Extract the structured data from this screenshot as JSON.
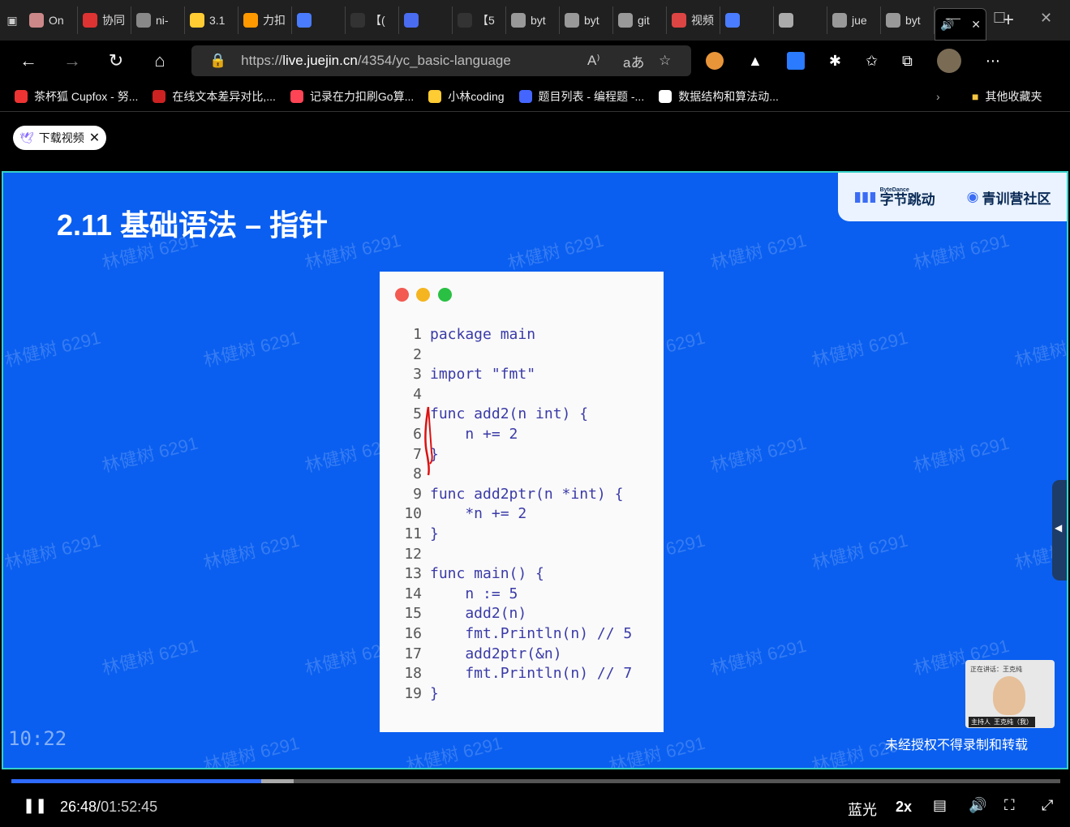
{
  "tabs": [
    {
      "label": "On",
      "color": "#c88"
    },
    {
      "label": "协同",
      "color": "#d33"
    },
    {
      "label": "ni-",
      "color": "#888"
    },
    {
      "label": "3.1",
      "color": "#fc3"
    },
    {
      "label": "力扣",
      "color": "#f90"
    },
    {
      "label": "",
      "color": "#4a7cff"
    },
    {
      "label": "【(",
      "color": "#333"
    },
    {
      "label": "",
      "color": "#4a6cf0"
    },
    {
      "label": "【5",
      "color": "#333"
    },
    {
      "label": "byt",
      "color": "#999"
    },
    {
      "label": "byt",
      "color": "#999"
    },
    {
      "label": "git",
      "color": "#999"
    },
    {
      "label": "视频",
      "color": "#d44"
    },
    {
      "label": "",
      "color": "#4a7cff"
    },
    {
      "label": "",
      "color": "#aaa"
    },
    {
      "label": "jue",
      "color": "#999"
    },
    {
      "label": "byt",
      "color": "#999"
    }
  ],
  "active_tab": {
    "label": "🔊",
    "close": "✕"
  },
  "new_tab": "+",
  "window": {
    "min": "—",
    "max": "☐",
    "close": "✕"
  },
  "url": {
    "scheme": "https://",
    "host": "live.juejin.cn",
    "path": "/4354/yc_basic-language"
  },
  "bookmarks": [
    {
      "label": "茶杯狐 Cupfox - 努...",
      "color": "#e33"
    },
    {
      "label": "在线文本差异对比,...",
      "color": "#c22"
    },
    {
      "label": "记录在力扣刷Go算...",
      "color": "#f45"
    },
    {
      "label": "小林coding",
      "color": "#fc3"
    },
    {
      "label": "题目列表 - 编程题 -...",
      "color": "#46f"
    },
    {
      "label": "数据结构和算法动...",
      "color": "#fff"
    }
  ],
  "bookmarks_other": "其他收藏夹",
  "download_label": "下载视频",
  "slide": {
    "title": "2.11 基础语法 – 指针",
    "logo_bytedance": "字节跳动",
    "logo_bytedance_small": "ByteDance",
    "logo_camp": "青训营社区",
    "watermark": "林健树 6291",
    "notice": "未经授权不得录制和转载",
    "clock": "10:22",
    "speaker_label": "正在讲话：王克纯",
    "host_label": "主持人",
    "host_name": "王克纯（我）"
  },
  "code_lines": [
    {
      "n": "1",
      "text": "package main"
    },
    {
      "n": "2",
      "text": ""
    },
    {
      "n": "3",
      "text": "import \"fmt\""
    },
    {
      "n": "4",
      "text": ""
    },
    {
      "n": "5",
      "text": "func add2(n int) {"
    },
    {
      "n": "6",
      "text": "    n += 2"
    },
    {
      "n": "7",
      "text": "}"
    },
    {
      "n": "8",
      "text": ""
    },
    {
      "n": "9",
      "text": "func add2ptr(n *int) {"
    },
    {
      "n": "10",
      "text": "    *n += 2"
    },
    {
      "n": "11",
      "text": "}"
    },
    {
      "n": "12",
      "text": ""
    },
    {
      "n": "13",
      "text": "func main() {"
    },
    {
      "n": "14",
      "text": "    n := 5"
    },
    {
      "n": "15",
      "text": "    add2(n)"
    },
    {
      "n": "16",
      "text": "    fmt.Println(n) // 5"
    },
    {
      "n": "17",
      "text": "    add2ptr(&n)"
    },
    {
      "n": "18",
      "text": "    fmt.Println(n) // 7"
    },
    {
      "n": "19",
      "text": "}"
    }
  ],
  "player": {
    "current": "26:48",
    "sep": "/",
    "total": "01:52:45",
    "progress": 0.238,
    "buffered": 0.269,
    "quality": "蓝光",
    "speed": "2x"
  }
}
